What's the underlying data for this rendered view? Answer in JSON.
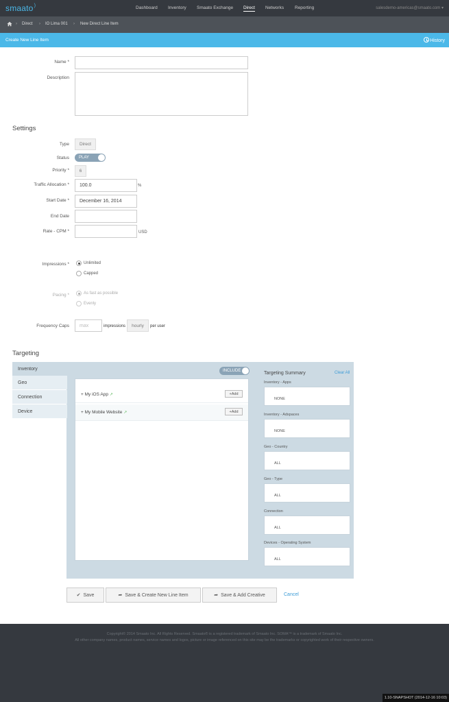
{
  "brand": {
    "name": "smaato"
  },
  "nav": {
    "items": [
      "Dashboard",
      "Inventory",
      "Smaato Exchange",
      "Direct",
      "Networks",
      "Reporting"
    ],
    "active": "Direct",
    "user": "salesdemo-americas@smaato.com"
  },
  "breadcrumb": {
    "items": [
      "Direct",
      "IO Lima 001",
      "New Direct Line Item"
    ]
  },
  "titlebar": {
    "title": "Create New Line Item",
    "history": "History"
  },
  "form": {
    "name_label": "Name",
    "description_label": "Description",
    "settings_heading": "Settings",
    "type_label": "Type",
    "type_value": "Direct",
    "status_label": "Status",
    "status_value": "PLAY",
    "priority_label": "Priority",
    "priority_value": "6",
    "traffic_label": "Traffic Allocation",
    "traffic_value": "100.0",
    "traffic_unit": "%",
    "start_label": "Start Date",
    "start_value": "December 16, 2014",
    "end_label": "End Date",
    "rate_label": "Rate - CPM",
    "rate_unit": "USD",
    "impressions_label": "Impressions",
    "impressions_unlimited": "Unlimited",
    "impressions_capped": "Capped",
    "pacing_label": "Pacing",
    "pacing_fast": "As fast as possible",
    "pacing_evenly": "Evenly",
    "freq_label": "Frequency Caps",
    "freq_placeholder": "max",
    "freq_impressions": "impressions",
    "freq_period": "hourly",
    "freq_per_user": "per user",
    "required_mark": "*"
  },
  "targeting": {
    "heading": "Targeting",
    "tabs": [
      "Inventory",
      "Geo",
      "Connection",
      "Device"
    ],
    "include_toggle": "INCLUDE",
    "inventory_items": [
      {
        "name": "My iOS App",
        "add": "+Add"
      },
      {
        "name": "My Mobile Website",
        "add": "+Add"
      }
    ],
    "summary": {
      "title": "Targeting Summary",
      "clear_all": "Clear All",
      "groups": [
        {
          "label": "Inventory - Apps",
          "value": "NONE"
        },
        {
          "label": "Inventory - Adspaces",
          "value": "NONE"
        },
        {
          "label": "Geo - Country",
          "value": "ALL"
        },
        {
          "label": "Geo - Type",
          "value": "ALL"
        },
        {
          "label": "Connection",
          "value": "ALL"
        },
        {
          "label": "Devices - Operating System",
          "value": "ALL"
        }
      ]
    }
  },
  "actions": {
    "save": "Save",
    "save_create": "Save & Create New Line Item",
    "save_creative": "Save & Add Creative",
    "cancel": "Cancel"
  },
  "footer": {
    "line1": "Copyright© 2014 Smaato Inc. All Rights Reserved. Smaato® is a registered trademark of Smaato Inc. SOMA™ is a trademark of Smaato Inc.",
    "line2": "All other company names, product names, service names and logos, picture or image referenced on this site may be the trademarks or copyrighted work of their respective owners.",
    "snapshot": "1.10-SNAPSHOT (2014-12-16 10:03)"
  }
}
